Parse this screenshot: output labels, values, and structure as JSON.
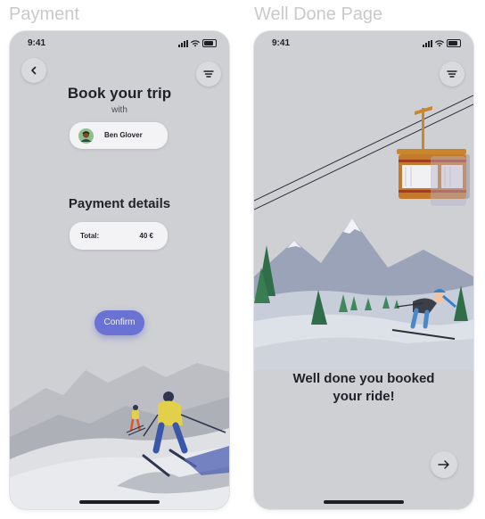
{
  "frames": {
    "payment_title": "Payment",
    "welldone_title": "Well Done Page"
  },
  "payment": {
    "status_time": "9:41",
    "heading": "Book your trip",
    "subheading": "with",
    "instructor_name": "Ben Glover",
    "details_heading": "Payment details",
    "total_label": "Total:",
    "total_value": "40 €",
    "confirm_label": "Confirm"
  },
  "welldone": {
    "status_time": "9:41",
    "message_line1": "Well done you booked",
    "message_line2": "your ride!"
  },
  "colors": {
    "background": "#cfd0d4",
    "accent": "#6a72d4",
    "text": "#1f2129"
  },
  "icons": {
    "back": "chevron-left-icon",
    "filter": "filter-lines-icon",
    "next": "arrow-right-icon"
  }
}
